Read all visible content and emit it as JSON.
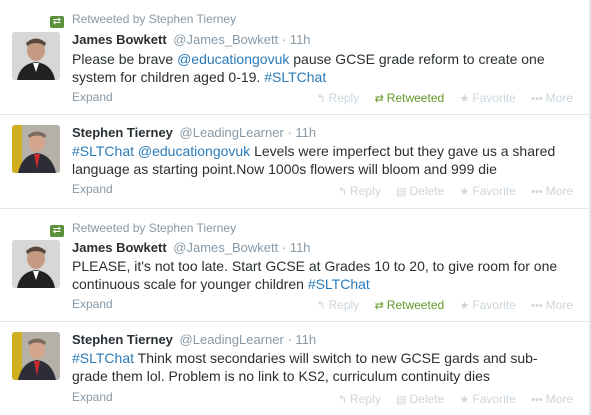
{
  "actions": {
    "reply": "Reply",
    "retweeted": "Retweeted",
    "retweet": "Retweet",
    "delete": "Delete",
    "favorite": "Favorite",
    "more": "More",
    "expand": "Expand"
  },
  "tweets": [
    {
      "retweeted_by": "Retweeted by Stephen Tierney",
      "name": "James Bowkett",
      "handle": "@James_Bowkett",
      "time": "· 11h",
      "t1": "Please be brave ",
      "t2": "@educationgovuk",
      "t3": " pause GCSE grade reform to create one",
      "t4": "system for children aged 0-19. ",
      "t5": "#SLTChat"
    },
    {
      "name": "Stephen Tierney",
      "handle": "@LeadingLearner",
      "time": "· 11h",
      "t1": "#SLTChat",
      "t2": " ",
      "t3": "@educationgovuk",
      "t4": " Levels were imperfect but they gave us a shared",
      "t5": "language as starting point.Now 1000s flowers will bloom and 999 die"
    },
    {
      "retweeted_by": "Retweeted by Stephen Tierney",
      "name": "James Bowkett",
      "handle": "@James_Bowkett",
      "time": "· 11h",
      "t1": "PLEASE, it's not too late. Start GCSE at Grades 10 to 20, to give room for one",
      "t2": "continuous scale for younger children ",
      "t3": "#SLTChat"
    },
    {
      "name": "Stephen Tierney",
      "handle": "@LeadingLearner",
      "time": "· 11h",
      "t1": "#SLTChat",
      "t2": " Think most secondaries will switch to new GCSE gards and sub-",
      "t3": "grade them lol. Problem is no link to KS2, curriculum continuity dies"
    }
  ]
}
